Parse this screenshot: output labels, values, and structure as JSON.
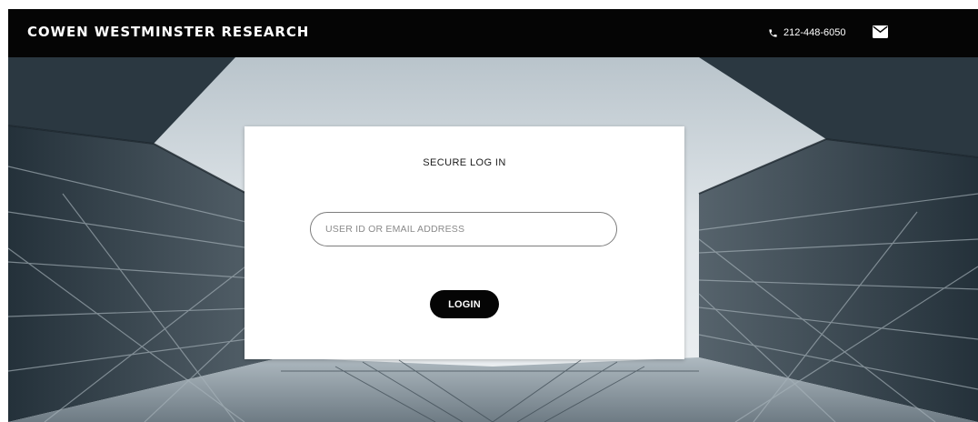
{
  "header": {
    "brand": "COWEN WESTMINSTER RESEARCH",
    "phone": "212-448-6050",
    "phone_icon": "phone-icon",
    "mail_icon": "mail-icon"
  },
  "login": {
    "title": "SECURE LOG IN",
    "user_field": {
      "placeholder": "USER ID OR EMAIL ADDRESS",
      "value": ""
    },
    "button_label": "LOGIN"
  },
  "colors": {
    "header_bg": "#050505",
    "button_bg": "#050505",
    "card_bg": "#ffffff",
    "hero_sky": "#cdd6dc",
    "hero_glass": "#2c3a43"
  }
}
